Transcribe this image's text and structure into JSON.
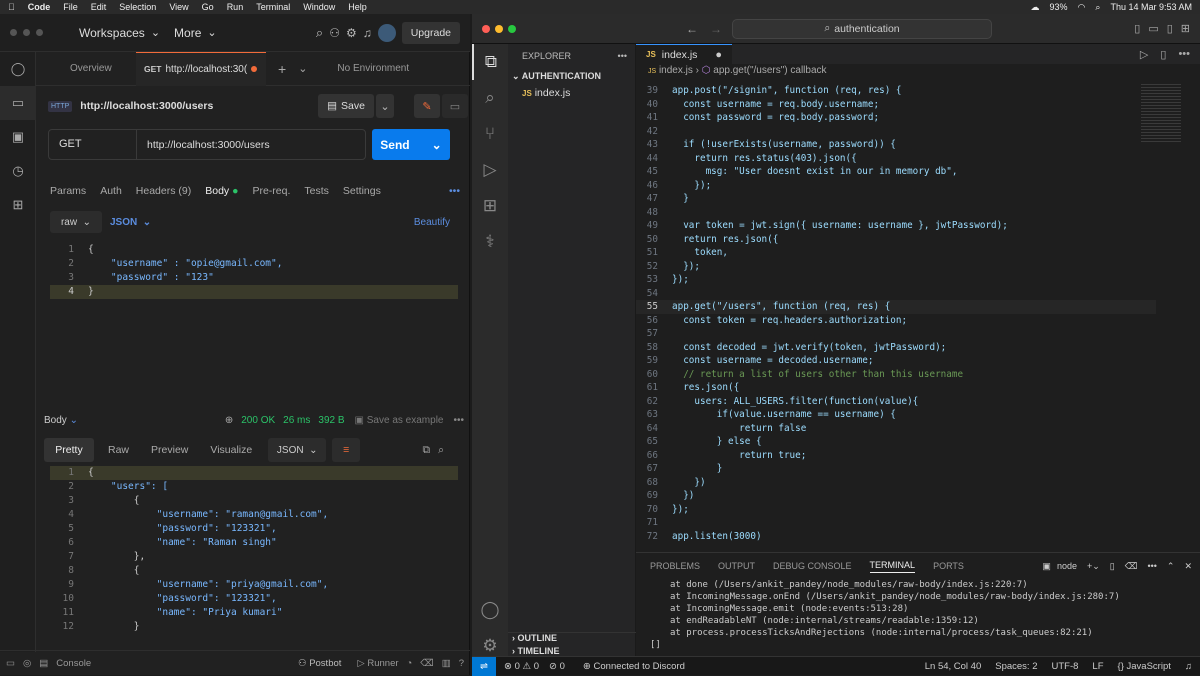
{
  "menubar": {
    "app": "Code",
    "items": [
      "File",
      "Edit",
      "Selection",
      "View",
      "Go",
      "Run",
      "Terminal",
      "Window",
      "Help"
    ],
    "battery": "93%",
    "datetime": "Thu 14 Mar  9:53 AM"
  },
  "postman": {
    "workspaces": "Workspaces",
    "more": "More",
    "upgrade": "Upgrade",
    "tab_overview": "Overview",
    "tab_method": "GET",
    "tab_url": "http://localhost:30(",
    "env": "No Environment",
    "req_title": "http://localhost:3000/users",
    "save": "Save",
    "method": "GET",
    "url": "http://localhost:3000/users",
    "send": "Send",
    "req_tabs": [
      "Params",
      "Auth",
      "Headers (9)",
      "Body",
      "Pre-req.",
      "Tests",
      "Settings"
    ],
    "body_mode": "raw",
    "body_format": "JSON",
    "beautify": "Beautify",
    "req_body": [
      [
        "1",
        "{"
      ],
      [
        "2",
        "    \"username\" : \"opie@gmail.com\","
      ],
      [
        "3",
        "    \"password\" : \"123\""
      ],
      [
        "4",
        "}"
      ]
    ],
    "resp_label": "Body",
    "status": "200 OK",
    "time": "26 ms",
    "size": "392 B",
    "save_example": "Save as example",
    "resp_tabs": [
      "Pretty",
      "Raw",
      "Preview",
      "Visualize"
    ],
    "resp_format": "JSON",
    "resp_body": [
      [
        "1",
        "{"
      ],
      [
        "2",
        "    \"users\": ["
      ],
      [
        "3",
        "        {"
      ],
      [
        "4",
        "            \"username\": \"raman@gmail.com\","
      ],
      [
        "5",
        "            \"password\": \"123321\","
      ],
      [
        "6",
        "            \"name\": \"Raman singh\""
      ],
      [
        "7",
        "        },"
      ],
      [
        "8",
        "        {"
      ],
      [
        "9",
        "            \"username\": \"priya@gmail.com\","
      ],
      [
        "10",
        "            \"password\": \"123321\","
      ],
      [
        "11",
        "            \"name\": \"Priya kumari\""
      ],
      [
        "12",
        "        }"
      ]
    ],
    "footer": {
      "console": "Console",
      "postbot": "Postbot",
      "runner": "Runner"
    }
  },
  "vscode": {
    "search": "authentication",
    "explorer": "EXPLORER",
    "folder": "AUTHENTICATION",
    "file": "index.js",
    "outline": "OUTLINE",
    "timeline": "TIMELINE",
    "tab": "index.js",
    "breadcrumb_file": "index.js",
    "breadcrumb_fn": "app.get(\"/users\") callback",
    "code": [
      [
        "39",
        "app.post(\"/signin\", function (req, res) {"
      ],
      [
        "40",
        "  const username = req.body.username;"
      ],
      [
        "41",
        "  const password = req.body.password;"
      ],
      [
        "42",
        ""
      ],
      [
        "43",
        "  if (!userExists(username, password)) {"
      ],
      [
        "44",
        "    return res.status(403).json({"
      ],
      [
        "45",
        "      msg: \"User doesnt exist in our in memory db\","
      ],
      [
        "46",
        "    });"
      ],
      [
        "47",
        "  }"
      ],
      [
        "48",
        ""
      ],
      [
        "49",
        "  var token = jwt.sign({ username: username }, jwtPassword);"
      ],
      [
        "50",
        "  return res.json({"
      ],
      [
        "51",
        "    token,"
      ],
      [
        "52",
        "  });"
      ],
      [
        "53",
        "});"
      ],
      [
        "54",
        ""
      ],
      [
        "55",
        "app.get(\"/users\", function (req, res) {"
      ],
      [
        "56",
        "  const token = req.headers.authorization;"
      ],
      [
        "57",
        ""
      ],
      [
        "58",
        "  const decoded = jwt.verify(token, jwtPassword);"
      ],
      [
        "59",
        "  const username = decoded.username;"
      ],
      [
        "60",
        "  // return a list of users other than this username"
      ],
      [
        "61",
        "  res.json({"
      ],
      [
        "62",
        "    users: ALL_USERS.filter(function(value){"
      ],
      [
        "63",
        "        if(value.username == username) {"
      ],
      [
        "64",
        "            return false"
      ],
      [
        "65",
        "        } else {"
      ],
      [
        "66",
        "            return true;"
      ],
      [
        "67",
        "        }"
      ],
      [
        "68",
        "    })"
      ],
      [
        "69",
        "  })"
      ],
      [
        "70",
        "});"
      ],
      [
        "71",
        ""
      ],
      [
        "72",
        "app.listen(3000)"
      ]
    ],
    "panel_tabs": [
      "PROBLEMS",
      "OUTPUT",
      "DEBUG CONSOLE",
      "TERMINAL",
      "PORTS"
    ],
    "term_shell": "node",
    "terminal": [
      "at done (/Users/ankit_pandey/node_modules/raw-body/index.js:220:7)",
      "at IncomingMessage.onEnd (/Users/ankit_pandey/node_modules/raw-body/index.js:280:7)",
      "at IncomingMessage.emit (node:events:513:28)",
      "at endReadableNT (node:internal/streams/readable:1359:12)",
      "at process.processTicksAndRejections (node:internal/process/task_queues:82:21)",
      "[]"
    ],
    "status": {
      "errors": "0",
      "warnings": "0",
      "ports": "0",
      "discord": "Connected to Discord",
      "pos": "Ln 54, Col 40",
      "spaces": "Spaces: 2",
      "enc": "UTF-8",
      "eol": "LF",
      "lang": "JavaScript"
    }
  }
}
